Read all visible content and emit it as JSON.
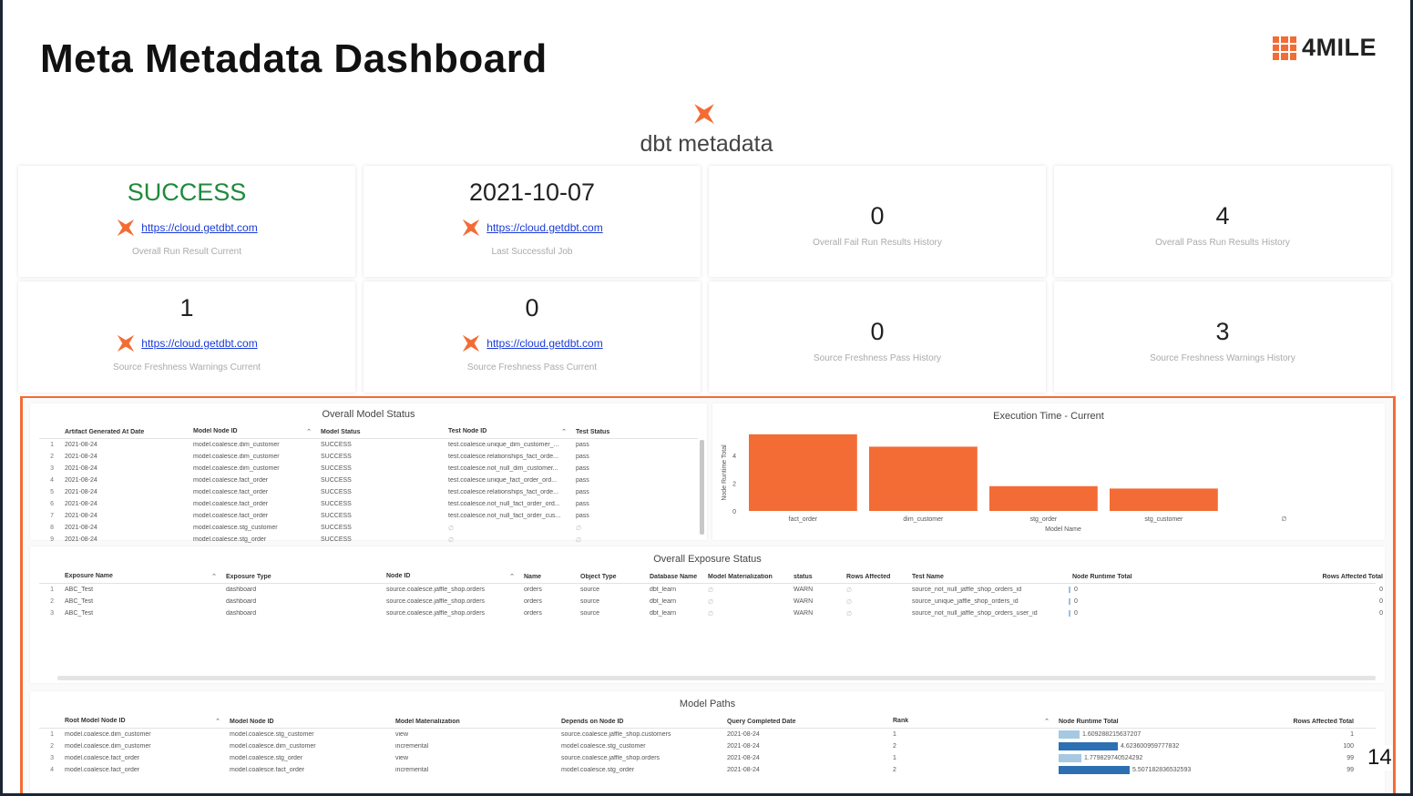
{
  "title": "Meta Metadata Dashboard",
  "logo": {
    "text": "4MILE"
  },
  "subtitle": "dbt metadata",
  "colors": {
    "brand": "#f36c35",
    "success": "#1f8a3c",
    "link": "#1a3ad6",
    "runtime_bar_light": "#a6c8e3",
    "runtime_bar_dark": "#2d6fb3"
  },
  "cards": [
    {
      "value": "SUCCESS",
      "link": "https://cloud.getdbt.com",
      "label": "Overall Run Result Current"
    },
    {
      "value": "2021-10-07",
      "link": "https://cloud.getdbt.com",
      "label": "Last Successful Job"
    },
    {
      "value": "0",
      "label": "Overall Fail Run Results History"
    },
    {
      "value": "4",
      "label": "Overall Pass Run Results History"
    },
    {
      "value": "1",
      "link": "https://cloud.getdbt.com",
      "label": "Source Freshness Warnings Current"
    },
    {
      "value": "0",
      "link": "https://cloud.getdbt.com",
      "label": "Source Freshness Pass Current"
    },
    {
      "value": "0",
      "label": "Source Freshness Pass History"
    },
    {
      "value": "3",
      "label": "Source Freshness Warnings History"
    }
  ],
  "model_status": {
    "title": "Overall Model Status",
    "columns": [
      "Artifact Generated At Date",
      "Model Node ID",
      "Model Status",
      "Test Node ID",
      "Test Status"
    ],
    "rows": [
      [
        "1",
        "2021-08-24",
        "model.coalesce.dim_customer",
        "SUCCESS",
        "test.coalesce.unique_dim_customer_...",
        "pass"
      ],
      [
        "2",
        "2021-08-24",
        "model.coalesce.dim_customer",
        "SUCCESS",
        "test.coalesce.relationships_fact_orde...",
        "pass"
      ],
      [
        "3",
        "2021-08-24",
        "model.coalesce.dim_customer",
        "SUCCESS",
        "test.coalesce.not_null_dim_customer...",
        "pass"
      ],
      [
        "4",
        "2021-08-24",
        "model.coalesce.fact_order",
        "SUCCESS",
        "test.coalesce.unique_fact_order_ord...",
        "pass"
      ],
      [
        "5",
        "2021-08-24",
        "model.coalesce.fact_order",
        "SUCCESS",
        "test.coalesce.relationships_fact_orde...",
        "pass"
      ],
      [
        "6",
        "2021-08-24",
        "model.coalesce.fact_order",
        "SUCCESS",
        "test.coalesce.not_null_fact_order_ord...",
        "pass"
      ],
      [
        "7",
        "2021-08-24",
        "model.coalesce.fact_order",
        "SUCCESS",
        "test.coalesce.not_null_fact_order_cus...",
        "pass"
      ],
      [
        "8",
        "2021-08-24",
        "model.coalesce.stg_customer",
        "SUCCESS",
        "∅",
        "∅"
      ],
      [
        "9",
        "2021-08-24",
        "model.coalesce.stg_order",
        "SUCCESS",
        "∅",
        "∅"
      ]
    ]
  },
  "execution_chart": {
    "title": "Execution Time - Current",
    "chart_data": {
      "type": "bar",
      "title": "Execution Time - Current",
      "xlabel": "Model Name",
      "ylabel": "Node Runtime Total",
      "categories": [
        "fact_order",
        "dim_customer",
        "stg_order",
        "stg_customer",
        "∅"
      ],
      "values": [
        5.51,
        4.62,
        1.78,
        1.61,
        0
      ],
      "ylim": [
        0,
        5.5
      ],
      "yticks": [
        "0",
        "2",
        "4"
      ],
      "color": "#f36c35",
      "grid": false
    }
  },
  "exposure": {
    "title": "Overall Exposure Status",
    "columns": [
      "Exposure Name",
      "Exposure Type",
      "Node ID",
      "Name",
      "Object Type",
      "Database Name",
      "Model Materialization",
      "status",
      "Rows Affected",
      "Test Name",
      "Node Runtime Total",
      "Rows Affected Total"
    ],
    "rows": [
      [
        "1",
        "ABC_Test",
        "dashboard",
        "source.coalesce.jaffle_shop.orders",
        "orders",
        "source",
        "dbt_learn",
        "∅",
        "WARN",
        "∅",
        "source_not_null_jaffle_shop_orders_id",
        "0",
        "0"
      ],
      [
        "2",
        "ABC_Test",
        "dashboard",
        "source.coalesce.jaffle_shop.orders",
        "orders",
        "source",
        "dbt_learn",
        "∅",
        "WARN",
        "∅",
        "source_unique_jaffle_shop_orders_id",
        "0",
        "0"
      ],
      [
        "3",
        "ABC_Test",
        "dashboard",
        "source.coalesce.jaffle_shop.orders",
        "orders",
        "source",
        "dbt_learn",
        "∅",
        "WARN",
        "∅",
        "source_not_null_jaffle_shop_orders_user_id",
        "0",
        "0"
      ]
    ]
  },
  "paths": {
    "title": "Model Paths",
    "columns": [
      "Root Model Node ID",
      "Model Node ID",
      "Model Materialization",
      "Depends on Node ID",
      "Query Completed Date",
      "Rank",
      "Node Runtime Total",
      "Rows Affected Total"
    ],
    "rows": [
      [
        "1",
        "model.coalesce.dim_customer",
        "model.coalesce.stg_customer",
        "view",
        "source.coalesce.jaffle_shop.customers",
        "2021-08-24",
        "1",
        "1.609288215637207",
        "1"
      ],
      [
        "2",
        "model.coalesce.dim_customer",
        "model.coalesce.dim_customer",
        "incremental",
        "model.coalesce.stg_customer",
        "2021-08-24",
        "2",
        "4.623600959777832",
        "100"
      ],
      [
        "3",
        "model.coalesce.fact_order",
        "model.coalesce.stg_order",
        "view",
        "source.coalesce.jaffle_shop.orders",
        "2021-08-24",
        "1",
        "1.779829740524292",
        "99"
      ],
      [
        "4",
        "model.coalesce.fact_order",
        "model.coalesce.fact_order",
        "incremental",
        "model.coalesce.stg_order",
        "2021-08-24",
        "2",
        "5.507182836532593",
        "99"
      ]
    ],
    "runtime_max": 5.507182836532593
  },
  "page_number": "14"
}
